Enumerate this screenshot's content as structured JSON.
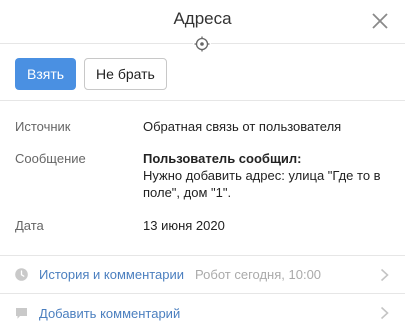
{
  "header": {
    "title": "Адреса"
  },
  "actions": {
    "take_label": "Взять",
    "skip_label": "Не брать"
  },
  "fields": {
    "source": {
      "label": "Источник",
      "value": "Обратная связь от пользователя"
    },
    "message": {
      "label": "Сообщение",
      "heading": "Пользователь сообщил:",
      "line1": "Нужно добавить адрес: улица \"Где то в",
      "line2": "поле\", дом \"1\"."
    },
    "date": {
      "label": "Дата",
      "value": "13 июня 2020"
    }
  },
  "footer": {
    "history": {
      "label": "История и комментарии",
      "meta": "Робот сегодня, 10:00"
    },
    "comment": {
      "label": "Добавить комментарий"
    }
  },
  "colors": {
    "accent": "#4a90e2",
    "link": "#4b7fbf",
    "muted": "#aaaaaa",
    "border": "#e6e6e6"
  },
  "icons": [
    "close-icon",
    "crosshair-icon",
    "clock-icon",
    "comment-icon",
    "chevron-right-icon"
  ]
}
